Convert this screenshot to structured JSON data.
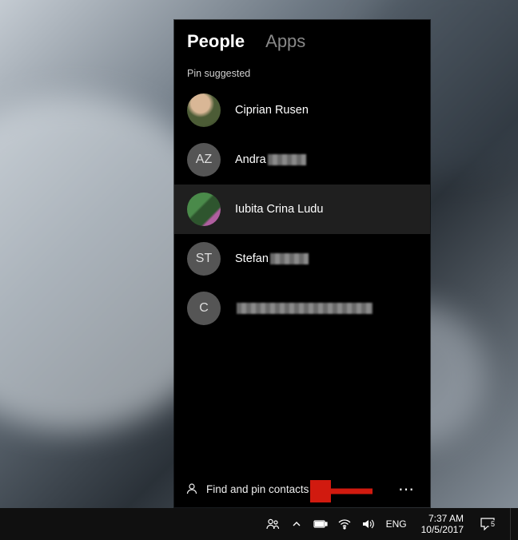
{
  "panel": {
    "tabs": {
      "people": "People",
      "apps": "Apps",
      "active": "people"
    },
    "section_label": "Pin suggested",
    "contacts": [
      {
        "name": "Ciprian Rusen",
        "initials": "",
        "avatar_type": "photo",
        "redacted": "none"
      },
      {
        "name": "Andra",
        "initials": "AZ",
        "avatar_type": "initials",
        "redacted": "partial"
      },
      {
        "name": "Iubita Crina Ludu",
        "initials": "",
        "avatar_type": "photo",
        "redacted": "none"
      },
      {
        "name": "Stefan",
        "initials": "ST",
        "avatar_type": "initials",
        "redacted": "partial"
      },
      {
        "name": "",
        "initials": "C",
        "avatar_type": "initials",
        "redacted": "full"
      }
    ],
    "footer": {
      "find_label": "Find and pin contacts",
      "more_label": "More options"
    }
  },
  "taskbar": {
    "lang": "ENG",
    "time": "7:37 AM",
    "date": "10/5/2017",
    "action_center_count": "5"
  },
  "annotation": {
    "type": "arrow",
    "color": "#d11a0f"
  }
}
